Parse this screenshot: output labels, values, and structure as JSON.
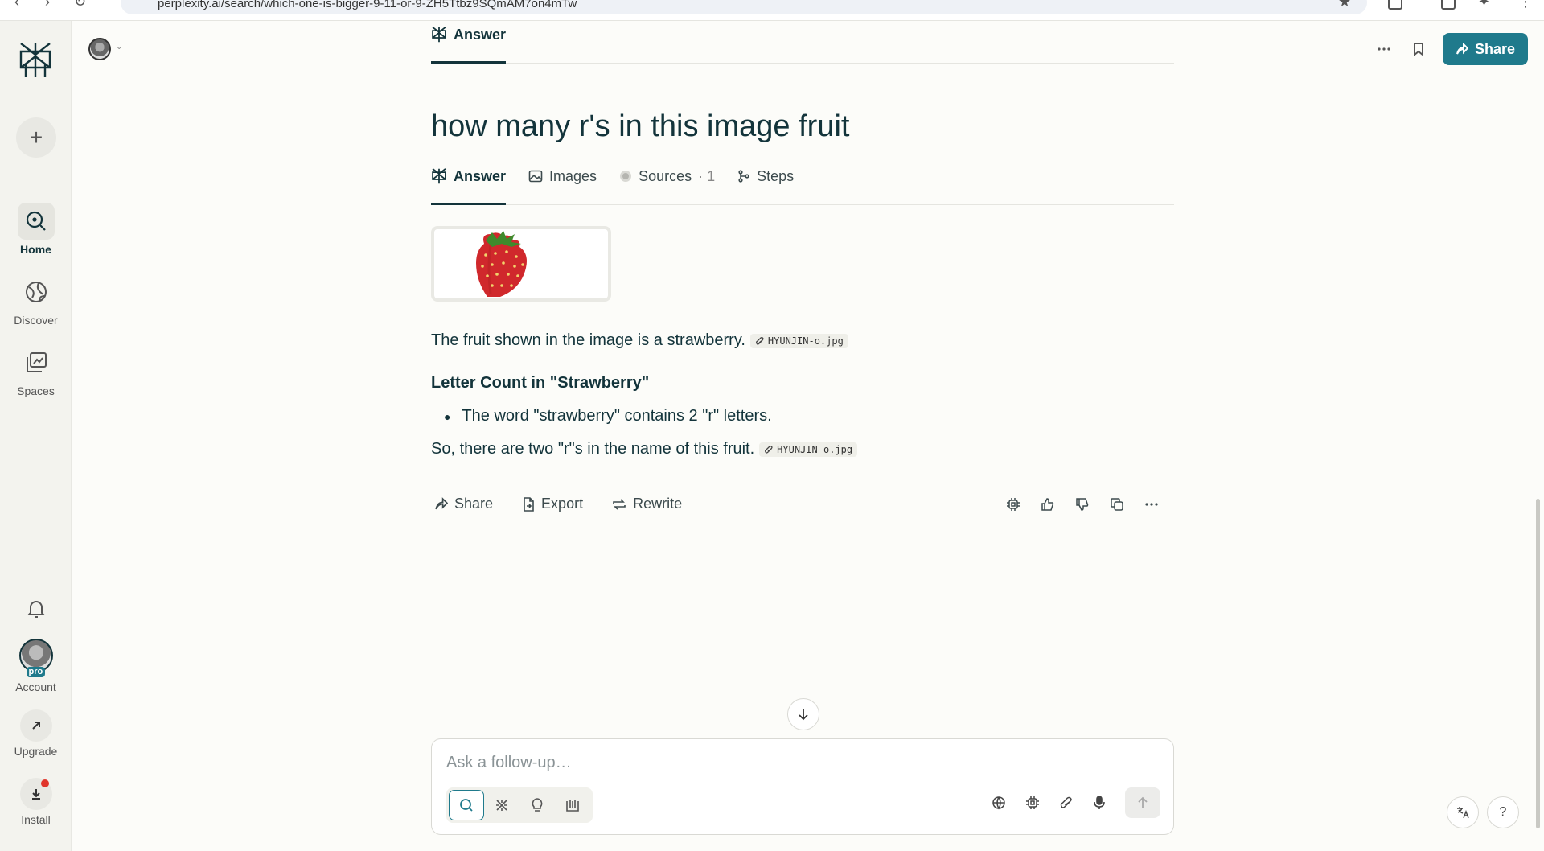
{
  "browser": {
    "url": "perplexity.ai/search/which-one-is-bigger-9-11-or-9-ZH5Ttbz9SQmAM7on4mTw"
  },
  "sidebar": {
    "items": [
      {
        "label": "Home",
        "icon": "search-icon"
      },
      {
        "label": "Discover",
        "icon": "globe-icon"
      },
      {
        "label": "Spaces",
        "icon": "spaces-icon"
      }
    ],
    "account_label": "Account",
    "pro_badge": "pro",
    "upgrade_label": "Upgrade",
    "install_label": "Install"
  },
  "header": {
    "tab_label": "Answer",
    "share_label": "Share"
  },
  "query": {
    "title": "how many r's in this image fruit",
    "tabs": [
      {
        "label": "Answer"
      },
      {
        "label": "Images"
      },
      {
        "label": "Sources",
        "count": "· 1"
      },
      {
        "label": "Steps"
      }
    ]
  },
  "answer": {
    "para1": "The fruit shown in the image is a strawberry.",
    "citation": "HYUNJIN-o.jpg",
    "heading": "Letter Count in \"Strawberry\"",
    "bullet": "The word \"strawberry\" contains 2 \"r\" letters.",
    "para2": "So, there are two \"r\"s in the name of this fruit."
  },
  "actions": {
    "share": "Share",
    "export": "Export",
    "rewrite": "Rewrite"
  },
  "followup": {
    "placeholder": "Ask a follow-up…"
  },
  "colors": {
    "accent": "#1f7a8c",
    "ink": "#13343b",
    "background": "#fcfcf9",
    "sidebar": "#f3f3ee",
    "notification": "#e0352b"
  }
}
